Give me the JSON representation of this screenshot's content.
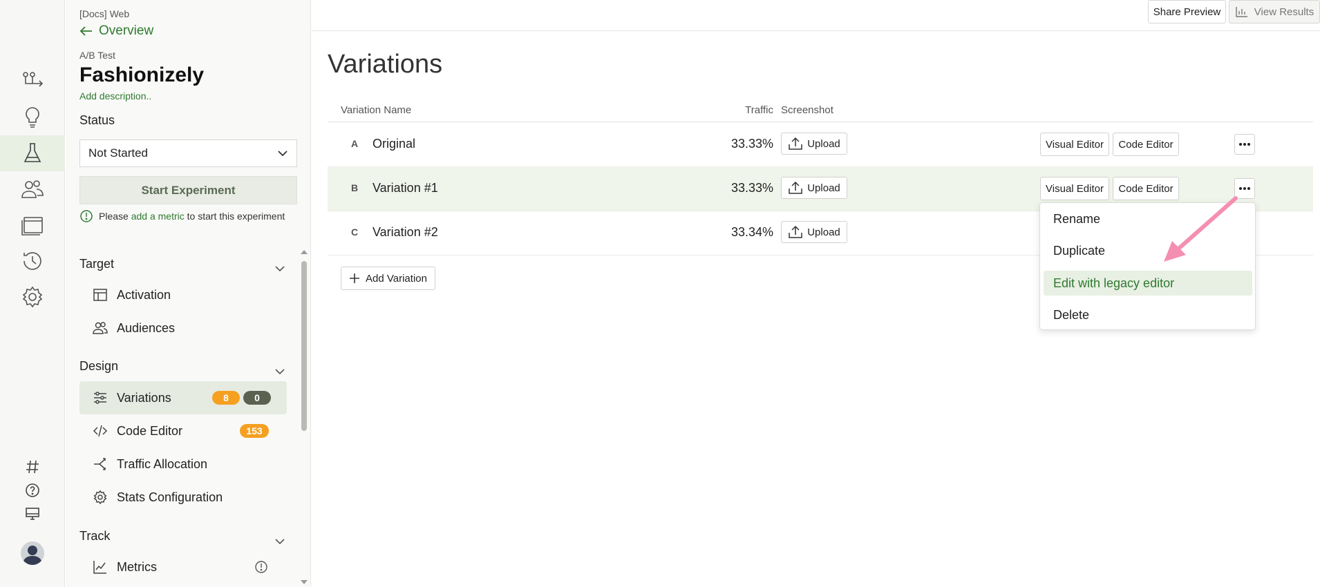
{
  "rail": {
    "icons": [
      "flow-icon",
      "lightbulb-icon",
      "flask-icon",
      "users-icon",
      "browser-icon",
      "history-icon",
      "gear-icon"
    ],
    "bottom_icons": [
      "hash-icon",
      "help-icon",
      "monitor-icon"
    ]
  },
  "sidebar": {
    "breadcrumb": "[Docs] Web",
    "back_label": "Overview",
    "type_label": "A/B Test",
    "title": "Fashionizely",
    "add_description": "Add description..",
    "status_label": "Status",
    "status_value": "Not Started",
    "start_button": "Start Experiment",
    "notice_prefix": "Please",
    "notice_link": "add a metric",
    "notice_suffix": "to start this experiment",
    "sections": {
      "target": {
        "title": "Target",
        "items": [
          {
            "label": "Activation"
          },
          {
            "label": "Audiences"
          }
        ]
      },
      "design": {
        "title": "Design",
        "items": [
          {
            "label": "Variations",
            "badge1": "8",
            "badge2": "0"
          },
          {
            "label": "Code Editor",
            "badge1": "153"
          },
          {
            "label": "Traffic Allocation"
          },
          {
            "label": "Stats Configuration"
          }
        ]
      },
      "track": {
        "title": "Track",
        "items": [
          {
            "label": "Metrics"
          }
        ]
      }
    }
  },
  "topbar": {
    "share_preview": "Share Preview",
    "view_results": "View Results"
  },
  "main": {
    "title": "Variations",
    "columns": {
      "name": "Variation Name",
      "traffic": "Traffic",
      "screenshot": "Screenshot"
    },
    "rows": [
      {
        "letter": "A",
        "name": "Original",
        "traffic": "33.33%"
      },
      {
        "letter": "B",
        "name": "Variation #1",
        "traffic": "33.33%"
      },
      {
        "letter": "C",
        "name": "Variation #2",
        "traffic": "33.34%"
      }
    ],
    "upload_label": "Upload",
    "visual_editor_label": "Visual Editor",
    "code_editor_label": "Code Editor",
    "add_variation": "Add Variation"
  },
  "menu": {
    "items": [
      "Rename",
      "Duplicate",
      "Edit with legacy editor",
      "Delete"
    ],
    "highlighted": "Edit with legacy editor"
  },
  "colors": {
    "accent": "#2f7a2f",
    "badge_orange": "#f5a020",
    "badge_dark": "#5b6151",
    "arrow": "#f48fb1"
  }
}
